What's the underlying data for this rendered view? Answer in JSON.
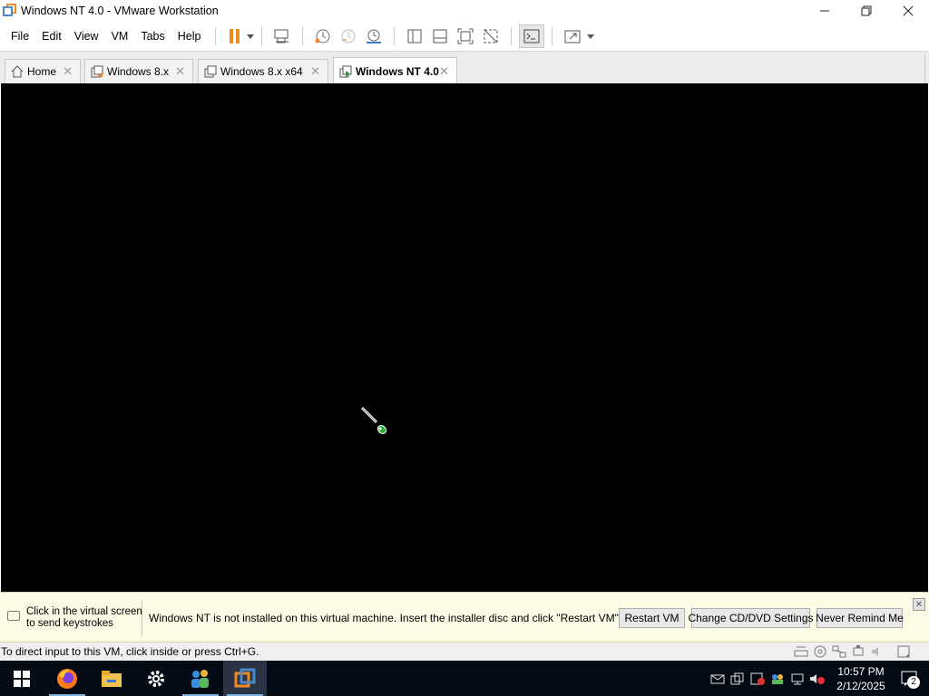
{
  "window": {
    "title": "Windows NT 4.0 - VMware Workstation",
    "controls": {
      "minimize": "—",
      "maximize": "❐",
      "close": "✕"
    }
  },
  "menu": {
    "items": [
      "File",
      "Edit",
      "View",
      "VM",
      "Tabs",
      "Help"
    ]
  },
  "toolbar": {
    "icons": [
      "pause-icon",
      "send-ctrl-alt-del-icon",
      "snapshot-take-icon",
      "snapshot-revert-icon",
      "snapshot-manager-icon",
      "show-library-icon",
      "show-thumbnail-bar-icon",
      "full-screen-icon",
      "unity-icon",
      "console-view-icon",
      "stretch-guest-icon"
    ],
    "accent": "#f08a24"
  },
  "tabs": [
    {
      "label": "Home",
      "icon": "home-icon",
      "active": false
    },
    {
      "label": "Windows 8.x",
      "icon": "vm-paused-icon",
      "active": false
    },
    {
      "label": "Windows 8.x x64",
      "icon": "vm-icon",
      "active": false
    },
    {
      "label": "Windows NT 4.0",
      "icon": "vm-running-icon",
      "active": true
    }
  ],
  "vm_screen": {
    "background": "#000000",
    "cursor": "busy-pointer-icon"
  },
  "notification": {
    "hint_line1": "Click in the virtual screen",
    "hint_line2": "to send keystrokes",
    "message": "Windows NT is not installed on this virtual machine. Insert the installer disc and click \"Restart VM\".",
    "buttons": {
      "restart": "Restart VM",
      "cd_settings": "Change CD/DVD Settings",
      "never_remind": "Never Remind Me"
    }
  },
  "status": {
    "text": "To direct input to this VM, click inside or press Ctrl+G."
  },
  "taskbar": {
    "apps": [
      "start-icon",
      "firefox-icon",
      "file-explorer-icon",
      "settings-icon",
      "network-people-icon",
      "vmware-workstation-icon"
    ],
    "time": "10:57 PM",
    "date": "2/12/2025",
    "notification_count": "2"
  }
}
